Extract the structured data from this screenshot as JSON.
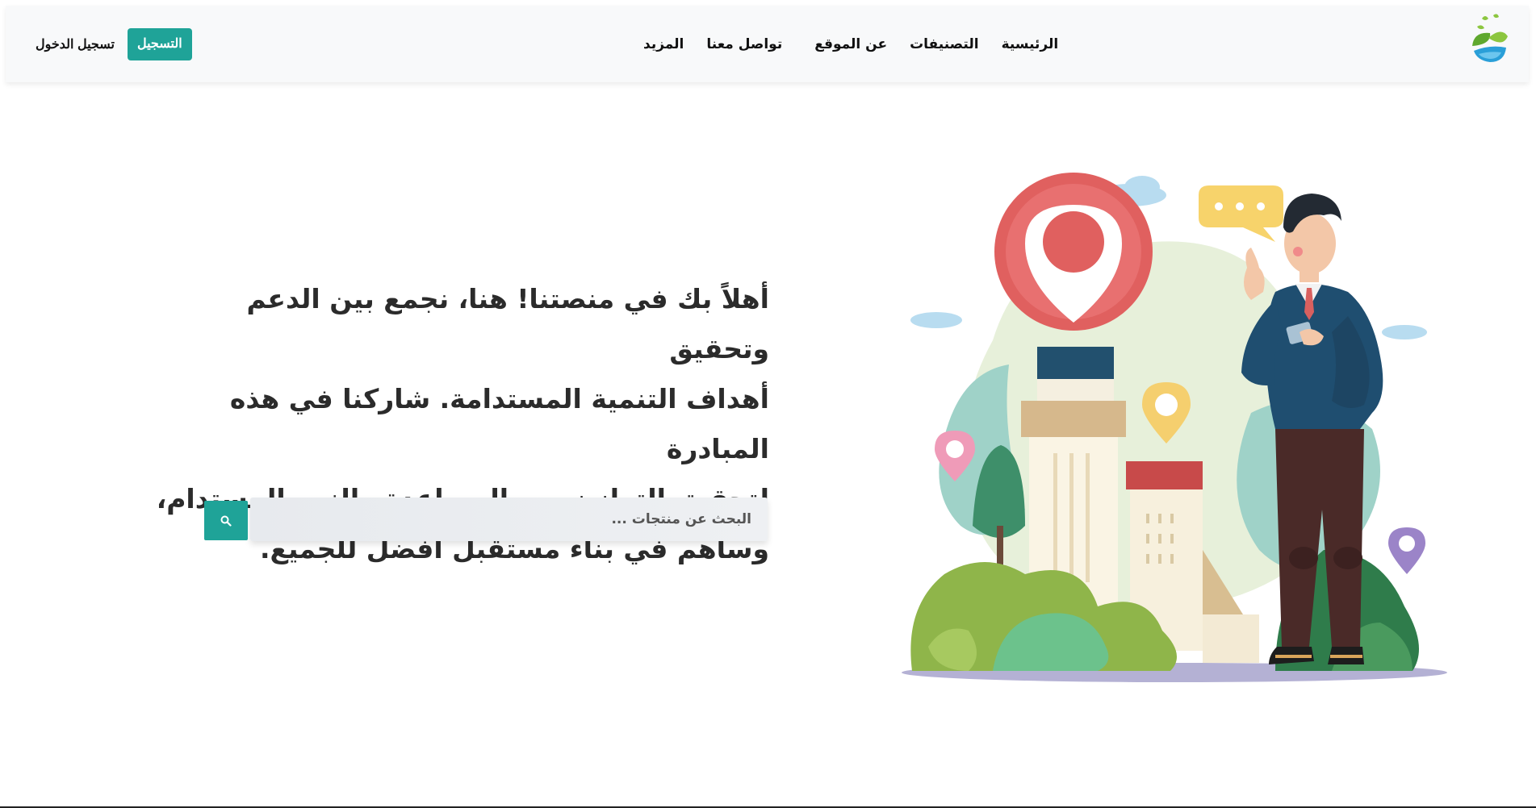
{
  "navbar": {
    "logo_name": "leaf-drop-logo",
    "links": [
      {
        "label": "الرئيسية"
      },
      {
        "label": "التصنيفات"
      },
      {
        "label": "عن الموقع"
      },
      {
        "label": "تواصل معنا"
      },
      {
        "label": "المزيد"
      }
    ],
    "register_label": "التسجيل",
    "login_label": "تسجيل الدخول"
  },
  "hero": {
    "lines": [
      "أهلاً بك في منصتنا! هنا، نجمع بين الدعم وتحقيق",
      "أهداف التنمية المستدامة. شاركنا في هذه المبادرة",
      "لتحقيق التوازن بين المساعدة والنمو المستدام،",
      "وساهم في بناء مستقبل أفضل للجميع."
    ]
  },
  "search": {
    "placeholder": "البحث عن منتجات ...",
    "value": "",
    "button_icon": "search-icon"
  },
  "colors": {
    "accent": "#1fa398",
    "navbar_bg": "#f8f9fa",
    "text": "#2b2b2b"
  }
}
